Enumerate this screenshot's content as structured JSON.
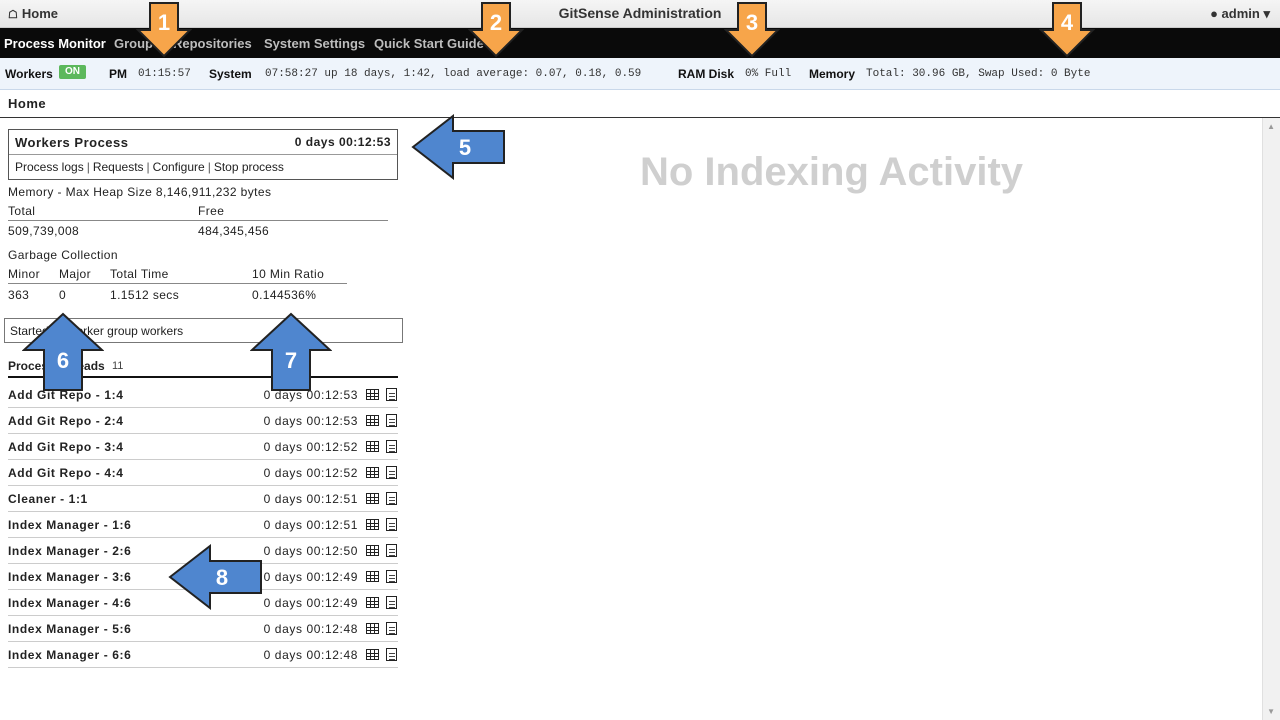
{
  "topbar": {
    "home": "Home",
    "title": "GitSense Administration",
    "user": "admin"
  },
  "nav": {
    "items": [
      "Process Monitor",
      "Groups",
      "Repositories",
      "System Settings",
      "Quick Start Guide"
    ]
  },
  "status": {
    "workers_label": "Workers",
    "workers_badge": "ON",
    "pm_label": "PM",
    "pm_value": "01:15:57",
    "system_label": "System",
    "system_value": "07:58:27 up 18 days, 1:42, load average: 0.07, 0.18, 0.59",
    "ramdisk_label": "RAM Disk",
    "ramdisk_value": "0% Full",
    "memory_label": "Memory",
    "memory_value": "Total: 30.96 GB, Swap Used: 0 Byte"
  },
  "breadcrumb": "Home",
  "workers_process": {
    "title": "Workers Process",
    "uptime": "0 days 00:12:53",
    "links": [
      "Process logs",
      "Requests",
      "Configure",
      "Stop process"
    ]
  },
  "memory": {
    "heading": "Memory - Max Heap Size 8,146,911,232 bytes",
    "total_label": "Total",
    "free_label": "Free",
    "total_value": "509,739,008",
    "free_value": "484,345,456"
  },
  "gc": {
    "heading": "Garbage Collection",
    "headers": [
      "Minor",
      "Major",
      "Total Time",
      "10 Min Ratio"
    ],
    "values": [
      "363",
      "0",
      "1.1512 secs",
      "0.144536%"
    ]
  },
  "started_message": "Started 11 worker group workers",
  "threads": {
    "heading": "Process Threads",
    "count": "11",
    "rows": [
      {
        "name": "Add Git Repo - 1:4",
        "time": "0 days 00:12:53"
      },
      {
        "name": "Add Git Repo - 2:4",
        "time": "0 days 00:12:53"
      },
      {
        "name": "Add Git Repo - 3:4",
        "time": "0 days 00:12:52"
      },
      {
        "name": "Add Git Repo - 4:4",
        "time": "0 days 00:12:52"
      },
      {
        "name": "Cleaner - 1:1",
        "time": "0 days 00:12:51"
      },
      {
        "name": "Index Manager - 1:6",
        "time": "0 days 00:12:51"
      },
      {
        "name": "Index Manager - 2:6",
        "time": "0 days 00:12:50"
      },
      {
        "name": "Index Manager - 3:6",
        "time": "0 days 00:12:49"
      },
      {
        "name": "Index Manager - 4:6",
        "time": "0 days 00:12:49"
      },
      {
        "name": "Index Manager - 5:6",
        "time": "0 days 00:12:48"
      },
      {
        "name": "Index Manager - 6:6",
        "time": "0 days 00:12:48"
      }
    ]
  },
  "no_activity": "No Indexing Activity",
  "callouts": [
    "1",
    "2",
    "3",
    "4",
    "5",
    "6",
    "7",
    "8"
  ],
  "colors": {
    "orange_arrow": "#f7a54a",
    "blue_arrow": "#4f86cf",
    "badge_green": "#5cb85c"
  }
}
